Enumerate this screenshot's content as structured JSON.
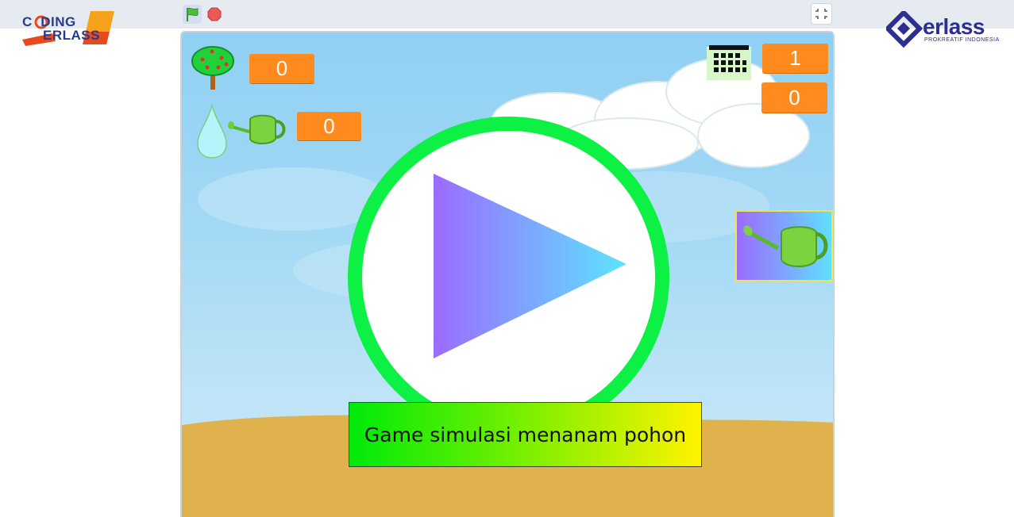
{
  "brands": {
    "left_logo_text": "CODING ERLASS",
    "right_logo_name": "erlass",
    "right_logo_tagline": "PROKREATIF  INDONESIA"
  },
  "controls": {
    "green_flag_icon": "green-flag-icon",
    "stop_icon": "stop-icon",
    "fullscreen_icon": "exit-fullscreen-icon"
  },
  "hud": {
    "tree_count": "0",
    "water_count": "0",
    "day_count": "1",
    "score": "0"
  },
  "banner": {
    "text": "Game simulasi menanam pohon"
  },
  "colors": {
    "counter": "#ff8a1d",
    "play_ring": "#0df044",
    "ground": "#e0b24d",
    "sky": "#a6daf5"
  }
}
